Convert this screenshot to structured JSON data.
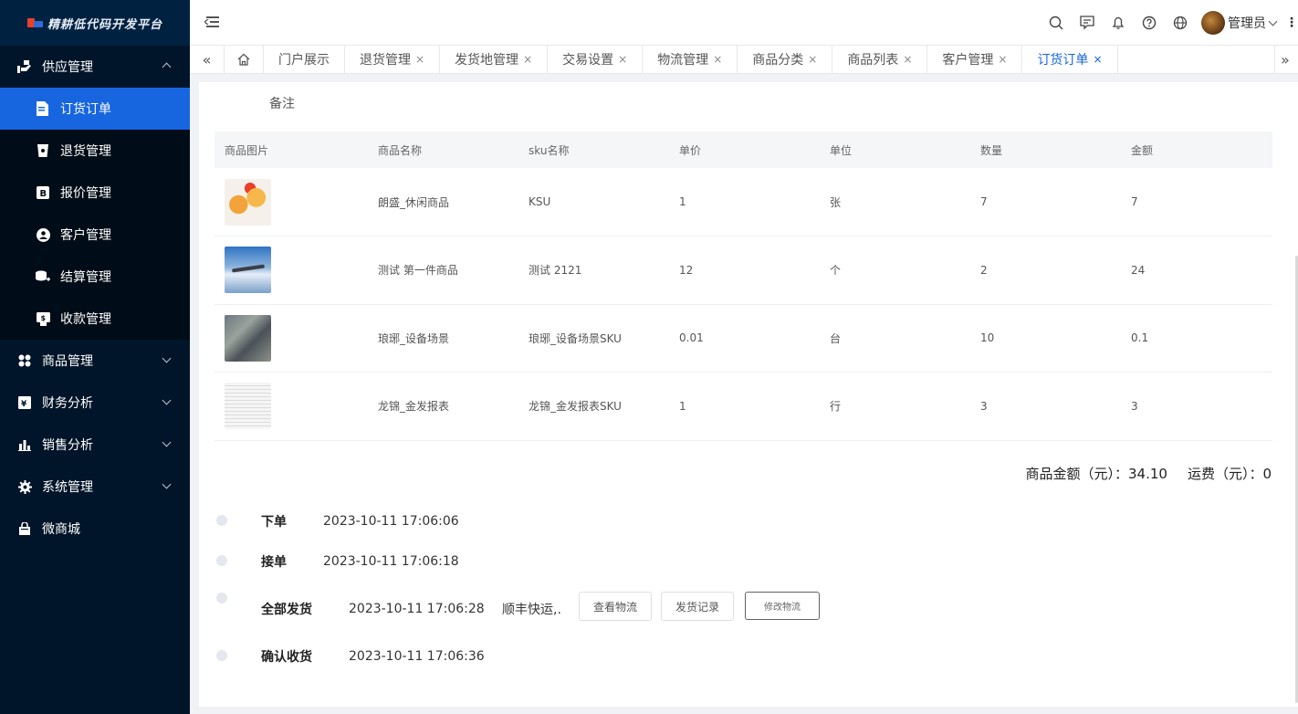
{
  "app": {
    "title": "精耕低代码开发平台"
  },
  "sidebar": {
    "groups": [
      {
        "label": "供应管理",
        "icon": "supply-icon",
        "expanded": true
      },
      {
        "label": "商品管理",
        "icon": "goods-icon",
        "expanded": false
      },
      {
        "label": "财务分析",
        "icon": "finance-icon",
        "expanded": false
      },
      {
        "label": "销售分析",
        "icon": "sales-chart-icon",
        "expanded": false
      },
      {
        "label": "系统管理",
        "icon": "gear-icon",
        "expanded": false
      },
      {
        "label": "微商城",
        "icon": "shop-bag-icon",
        "expanded": false
      }
    ],
    "supply_items": [
      {
        "label": "订货订单",
        "icon": "order-doc-icon",
        "active": true
      },
      {
        "label": "退货管理",
        "icon": "return-cup-icon",
        "active": false
      },
      {
        "label": "报价管理",
        "icon": "quote-icon",
        "active": false
      },
      {
        "label": "客户管理",
        "icon": "user-circle-icon",
        "active": false
      },
      {
        "label": "结算管理",
        "icon": "settlement-coins-icon",
        "active": false
      },
      {
        "label": "收款管理",
        "icon": "collection-icon",
        "active": false
      }
    ],
    "active_color": "#1766e0",
    "bg_color": "#001529"
  },
  "header": {
    "username": "管理员",
    "icons": [
      "search-icon",
      "message-icon",
      "bell-icon",
      "help-icon",
      "globe-icon"
    ]
  },
  "tabs": [
    {
      "label": "门户展示",
      "closable": false,
      "active": false
    },
    {
      "label": "退货管理",
      "closable": true,
      "active": false
    },
    {
      "label": "发货地管理",
      "closable": true,
      "active": false
    },
    {
      "label": "交易设置",
      "closable": true,
      "active": false
    },
    {
      "label": "物流管理",
      "closable": true,
      "active": false
    },
    {
      "label": "商品分类",
      "closable": true,
      "active": false
    },
    {
      "label": "商品列表",
      "closable": true,
      "active": false
    },
    {
      "label": "客户管理",
      "closable": true,
      "active": false
    },
    {
      "label": "订货订单",
      "closable": true,
      "active": true
    }
  ],
  "order": {
    "remark_label": "备注",
    "columns": [
      "商品图片",
      "商品名称",
      "sku名称",
      "单价",
      "单位",
      "数量",
      "金额"
    ],
    "rows": [
      {
        "image": "product-food-image",
        "name": "朗盛_休闲商品",
        "sku": "KSU",
        "price": "1",
        "unit": "张",
        "qty": "7",
        "amount": "7"
      },
      {
        "image": "product-airplane-image",
        "name": "测试 第一件商品",
        "sku": "测试 2121",
        "price": "12",
        "unit": "个",
        "qty": "2",
        "amount": "24"
      },
      {
        "image": "product-equipment-image",
        "name": "琅琊_设备场景",
        "sku": "琅琊_设备场景SKU",
        "price": "0.01",
        "unit": "台",
        "qty": "10",
        "amount": "0.1"
      },
      {
        "image": "product-report-image",
        "name": "龙锦_金发报表",
        "sku": "龙锦_金发报表SKU",
        "price": "1",
        "unit": "行",
        "qty": "3",
        "amount": "3"
      }
    ],
    "summary": {
      "goods_amount_label": "商品金额（元）：",
      "goods_amount": "34.10",
      "freight_label": "运费（元）：",
      "freight": "0"
    },
    "timeline": [
      {
        "label": "下单",
        "time": "2023-10-11 17:06:06"
      },
      {
        "label": "接单",
        "time": "2023-10-11 17:06:18"
      },
      {
        "label": "全部发货",
        "time": "2023-10-11 17:06:28",
        "carrier": "顺丰快运,.",
        "buttons": [
          "查看物流",
          "发货记录",
          "修改物流"
        ]
      },
      {
        "label": "确认收货",
        "time": "2023-10-11 17:06:36"
      }
    ]
  }
}
